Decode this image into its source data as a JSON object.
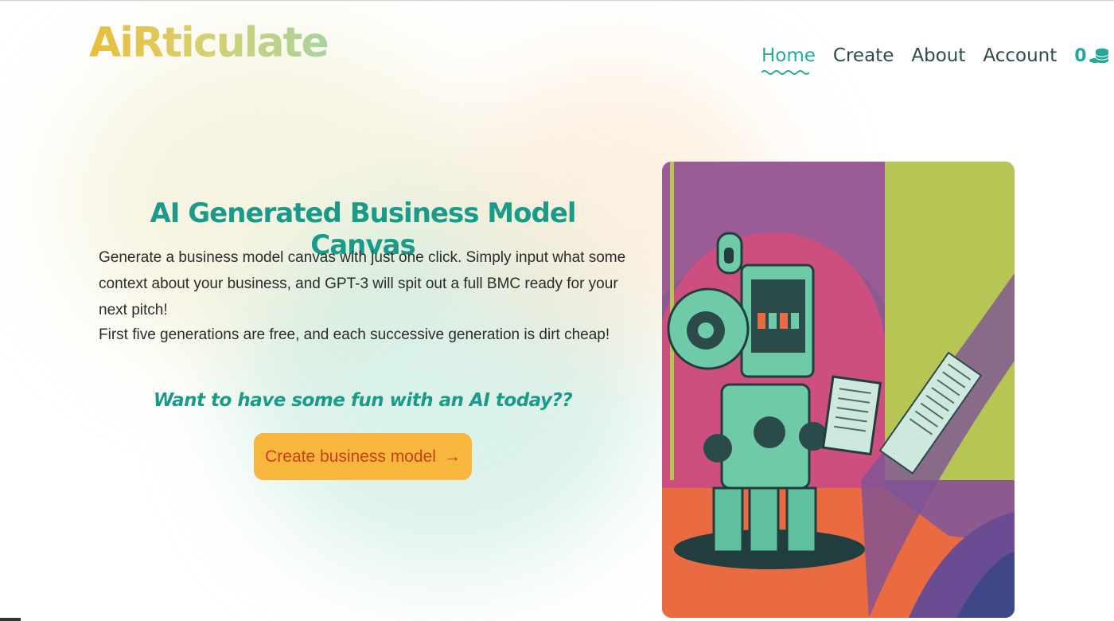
{
  "header": {
    "logo_text": "AiRticulate",
    "nav": [
      {
        "label": "Home",
        "active": true
      },
      {
        "label": "Create",
        "active": false
      },
      {
        "label": "About",
        "active": false
      },
      {
        "label": "Account",
        "active": false
      }
    ],
    "credits": "0",
    "credits_icon": "coins-icon"
  },
  "hero": {
    "title": "AI Generated Business Model Canvas",
    "description_1": "Generate a business model canvas with just one click. Simply input what some context about your business, and GPT-3 will spit out a full BMC ready for your next pitch!",
    "description_2": "First five generations are free, and each successive generation is dirt cheap!",
    "cta_text": "Want to have some fun with an AI today??",
    "button_label": "Create business model",
    "button_icon": "arrow-right-icon",
    "image_icon": "robot-reading-illustration"
  },
  "colors": {
    "accent": "#23a99a",
    "button_bg": "#f6b73c",
    "button_text": "#c7401c"
  }
}
